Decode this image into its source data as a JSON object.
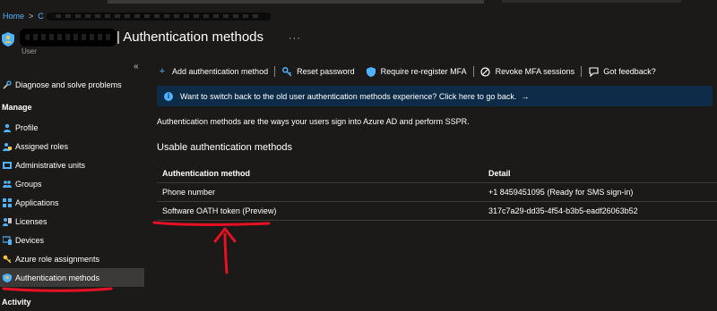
{
  "breadcrumb": {
    "home": "Home",
    "separator": ">",
    "crumb": "C"
  },
  "header": {
    "title": "| Authentication methods",
    "more": "···",
    "subtitle": "User"
  },
  "sidebar": {
    "collapse": "«",
    "top_item": {
      "label": "Diagnose and solve problems",
      "icon": "wrench-icon"
    },
    "section_manage": "Manage",
    "items": [
      {
        "label": "Profile",
        "icon": "person-icon"
      },
      {
        "label": "Assigned roles",
        "icon": "roles-icon"
      },
      {
        "label": "Administrative units",
        "icon": "admin-units-icon"
      },
      {
        "label": "Groups",
        "icon": "groups-icon"
      },
      {
        "label": "Applications",
        "icon": "applications-icon"
      },
      {
        "label": "Licenses",
        "icon": "licenses-icon"
      },
      {
        "label": "Devices",
        "icon": "devices-icon"
      },
      {
        "label": "Azure role assignments",
        "icon": "key-icon"
      },
      {
        "label": "Authentication methods",
        "icon": "shield-icon",
        "selected": true
      }
    ],
    "section_activity": "Activity"
  },
  "toolbar": {
    "add": "Add authentication method",
    "reset": "Reset password",
    "reregister": "Require re-register MFA",
    "revoke": "Revoke MFA sessions",
    "feedback": "Got feedback?"
  },
  "banner": {
    "text": "Want to switch back to the old user authentication methods experience? Click here to go back.",
    "arrow": "→"
  },
  "description": "Authentication methods are the ways your users sign into Azure AD and perform SSPR.",
  "section_title": "Usable authentication methods",
  "table": {
    "columns": [
      "Authentication method",
      "Detail"
    ],
    "rows": [
      {
        "method": "Phone number",
        "detail": "+1 8459451095 (Ready for SMS sign-in)"
      },
      {
        "method": "Software OATH token (Preview)",
        "detail": "317c7a29-dd35-4f54-b3b5-eadf26063b52"
      }
    ]
  },
  "colors": {
    "accent": "#4fb3ff",
    "background": "#1b1a19",
    "banner": "#0e2b47",
    "selected": "#3b3a39",
    "annotation": "#e81123"
  }
}
